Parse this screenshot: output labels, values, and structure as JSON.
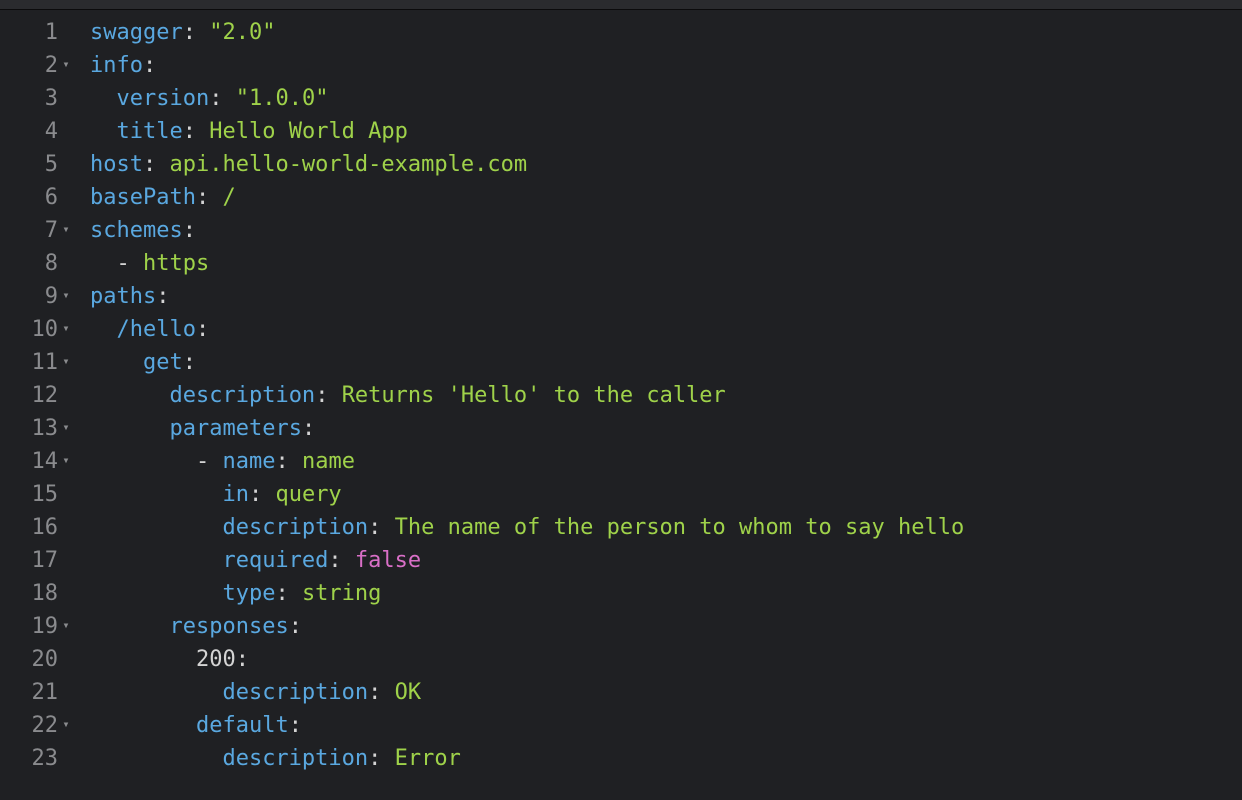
{
  "topbar": {},
  "gutter": {
    "lines": [
      "1",
      "2",
      "3",
      "4",
      "5",
      "6",
      "7",
      "8",
      "9",
      "10",
      "11",
      "12",
      "13",
      "14",
      "15",
      "16",
      "17",
      "18",
      "19",
      "20",
      "21",
      "22",
      "23"
    ],
    "fold_lines": [
      2,
      7,
      9,
      10,
      11,
      13,
      14,
      19,
      22
    ]
  },
  "code": {
    "lines": [
      [
        {
          "cls": "key",
          "t": "swagger"
        },
        {
          "cls": "punct",
          "t": ": "
        },
        {
          "cls": "str",
          "t": "\"2.0\""
        }
      ],
      [
        {
          "cls": "key",
          "t": "info"
        },
        {
          "cls": "punct",
          "t": ":"
        }
      ],
      [
        {
          "cls": "plain",
          "t": "  "
        },
        {
          "cls": "key",
          "t": "version"
        },
        {
          "cls": "punct",
          "t": ": "
        },
        {
          "cls": "str",
          "t": "\"1.0.0\""
        }
      ],
      [
        {
          "cls": "plain",
          "t": "  "
        },
        {
          "cls": "key",
          "t": "title"
        },
        {
          "cls": "punct",
          "t": ": "
        },
        {
          "cls": "str",
          "t": "Hello World App"
        }
      ],
      [
        {
          "cls": "key",
          "t": "host"
        },
        {
          "cls": "punct",
          "t": ": "
        },
        {
          "cls": "str",
          "t": "api.hello-world-example.com"
        }
      ],
      [
        {
          "cls": "key",
          "t": "basePath"
        },
        {
          "cls": "punct",
          "t": ": "
        },
        {
          "cls": "str",
          "t": "/"
        }
      ],
      [
        {
          "cls": "key",
          "t": "schemes"
        },
        {
          "cls": "punct",
          "t": ":"
        }
      ],
      [
        {
          "cls": "plain",
          "t": "  "
        },
        {
          "cls": "punct",
          "t": "- "
        },
        {
          "cls": "str",
          "t": "https"
        }
      ],
      [
        {
          "cls": "key",
          "t": "paths"
        },
        {
          "cls": "punct",
          "t": ":"
        }
      ],
      [
        {
          "cls": "plain",
          "t": "  "
        },
        {
          "cls": "key",
          "t": "/hello"
        },
        {
          "cls": "punct",
          "t": ":"
        }
      ],
      [
        {
          "cls": "plain",
          "t": "    "
        },
        {
          "cls": "key",
          "t": "get"
        },
        {
          "cls": "punct",
          "t": ":"
        }
      ],
      [
        {
          "cls": "plain",
          "t": "      "
        },
        {
          "cls": "key",
          "t": "description"
        },
        {
          "cls": "punct",
          "t": ": "
        },
        {
          "cls": "str",
          "t": "Returns 'Hello' to the caller"
        }
      ],
      [
        {
          "cls": "plain",
          "t": "      "
        },
        {
          "cls": "key",
          "t": "parameters"
        },
        {
          "cls": "punct",
          "t": ":"
        }
      ],
      [
        {
          "cls": "plain",
          "t": "        "
        },
        {
          "cls": "punct",
          "t": "- "
        },
        {
          "cls": "key",
          "t": "name"
        },
        {
          "cls": "punct",
          "t": ": "
        },
        {
          "cls": "str",
          "t": "name"
        }
      ],
      [
        {
          "cls": "plain",
          "t": "          "
        },
        {
          "cls": "key",
          "t": "in"
        },
        {
          "cls": "punct",
          "t": ": "
        },
        {
          "cls": "str",
          "t": "query"
        }
      ],
      [
        {
          "cls": "plain",
          "t": "          "
        },
        {
          "cls": "key",
          "t": "description"
        },
        {
          "cls": "punct",
          "t": ": "
        },
        {
          "cls": "str",
          "t": "The name of the person to whom to say hello"
        }
      ],
      [
        {
          "cls": "plain",
          "t": "          "
        },
        {
          "cls": "key",
          "t": "required"
        },
        {
          "cls": "punct",
          "t": ": "
        },
        {
          "cls": "bool",
          "t": "false"
        }
      ],
      [
        {
          "cls": "plain",
          "t": "          "
        },
        {
          "cls": "key",
          "t": "type"
        },
        {
          "cls": "punct",
          "t": ": "
        },
        {
          "cls": "str",
          "t": "string"
        }
      ],
      [
        {
          "cls": "plain",
          "t": "      "
        },
        {
          "cls": "key",
          "t": "responses"
        },
        {
          "cls": "punct",
          "t": ":"
        }
      ],
      [
        {
          "cls": "plain",
          "t": "        "
        },
        {
          "cls": "num",
          "t": "200"
        },
        {
          "cls": "punct",
          "t": ":"
        }
      ],
      [
        {
          "cls": "plain",
          "t": "          "
        },
        {
          "cls": "key",
          "t": "description"
        },
        {
          "cls": "punct",
          "t": ": "
        },
        {
          "cls": "str",
          "t": "OK"
        }
      ],
      [
        {
          "cls": "plain",
          "t": "        "
        },
        {
          "cls": "key",
          "t": "default"
        },
        {
          "cls": "punct",
          "t": ":"
        }
      ],
      [
        {
          "cls": "plain",
          "t": "          "
        },
        {
          "cls": "key",
          "t": "description"
        },
        {
          "cls": "punct",
          "t": ": "
        },
        {
          "cls": "str",
          "t": "Error"
        }
      ]
    ]
  }
}
